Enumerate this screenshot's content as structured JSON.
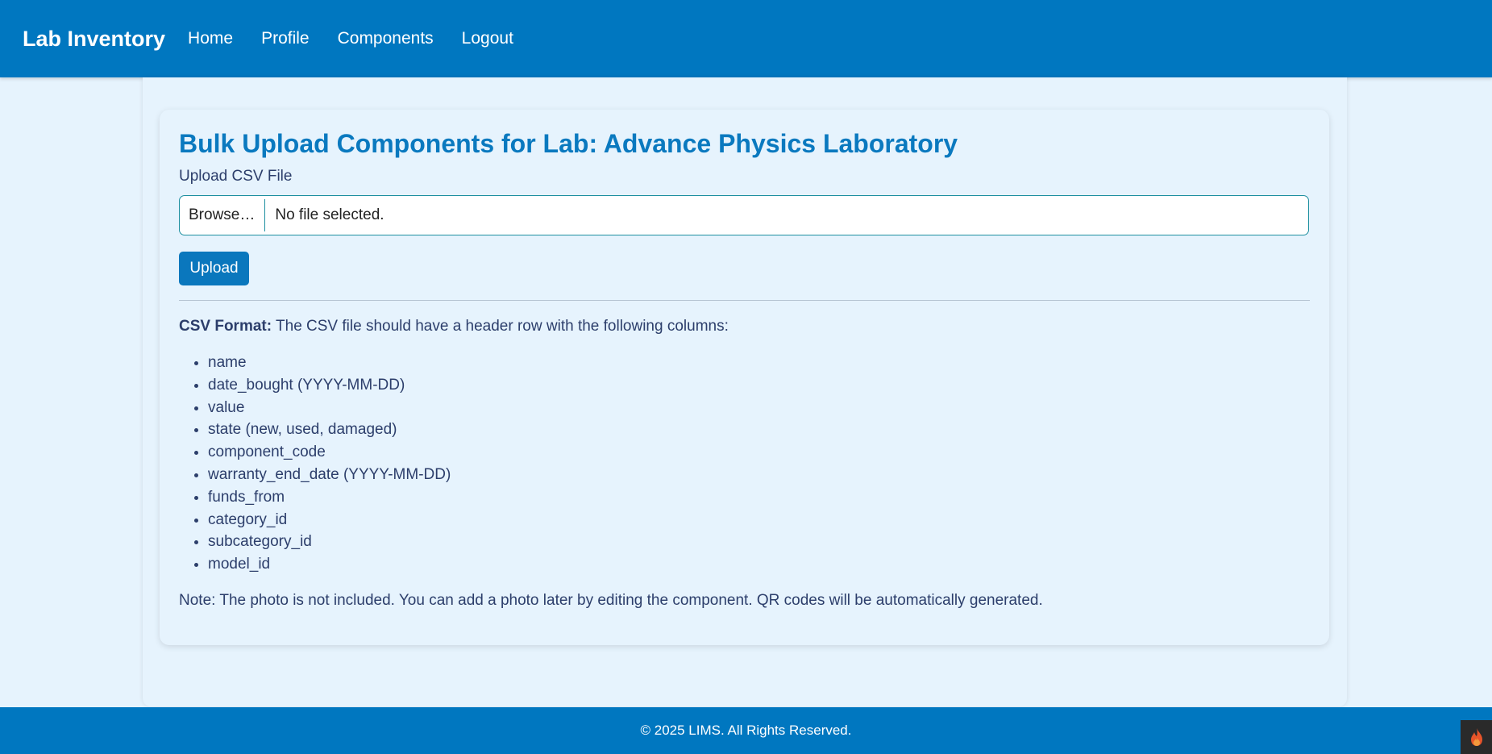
{
  "nav": {
    "brand": "Lab Inventory",
    "links": [
      "Home",
      "Profile",
      "Components",
      "Logout"
    ]
  },
  "main": {
    "title": "Bulk Upload Components for Lab: Advance Physics Laboratory",
    "upload_label": "Upload CSV File",
    "file_input": {
      "browse_label": "Browse…",
      "status": "No file selected."
    },
    "upload_button": "Upload",
    "csv_format": {
      "label": "CSV Format:",
      "text": "The CSV file should have a header row with the following columns:",
      "columns": [
        "name",
        "date_bought (YYYY-MM-DD)",
        "value",
        "state (new, used, damaged)",
        "component_code",
        "warranty_end_date (YYYY-MM-DD)",
        "funds_from",
        "category_id",
        "subcategory_id",
        "model_id"
      ]
    },
    "note": "Note: The photo is not included. You can add a photo later by editing the component. QR codes will be automatically generated."
  },
  "footer": {
    "text": "© 2025 LIMS. All Rights Reserved."
  },
  "icons": {
    "corner_badge": "flame-icon"
  },
  "colors": {
    "primary": "#0077c0",
    "title": "#0a79bf",
    "background": "#e6f3fd",
    "text": "#2c3e6b"
  }
}
